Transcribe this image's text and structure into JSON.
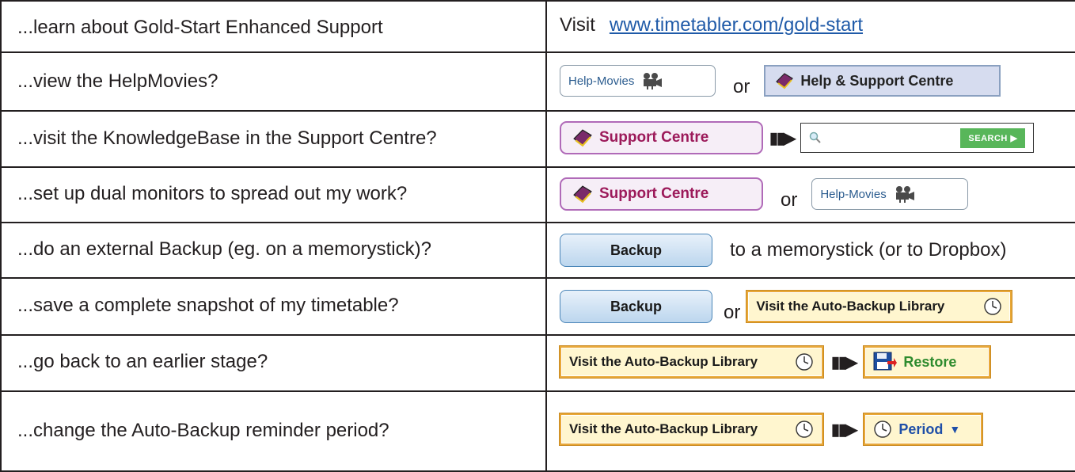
{
  "rows": [
    {
      "question": "...learn about Gold-Start Enhanced Support",
      "prefix": "Visit",
      "link": "www.timetabler.com/gold-start"
    },
    {
      "question": "...view the HelpMovies?"
    },
    {
      "question": "...visit the KnowledgeBase in the Support Centre?"
    },
    {
      "question": "...set up dual monitors to spread out my work?"
    },
    {
      "question": "...do an external Backup (eg. on a memorystick)?",
      "suffix": "to a memorystick (or to Dropbox)"
    },
    {
      "question": "...save a complete snapshot of my timetable?"
    },
    {
      "question": "...go back to an earlier stage?"
    },
    {
      "question": "...change the Auto-Backup reminder period?"
    }
  ],
  "labels": {
    "or": "or",
    "help_movies": "Help-Movies",
    "help_support_centre": "Help & Support Centre",
    "support_centre": "Support Centre",
    "search": "SEARCH",
    "backup": "Backup",
    "auto_backup_library": "Visit the Auto-Backup Library",
    "restore": "Restore",
    "period": "Period"
  },
  "icons": [
    "film-camera-icon",
    "book-icon",
    "magnifier-icon",
    "arrow-right-icon",
    "clock-icon",
    "floppy-disk-icon",
    "dropdown-arrow-icon"
  ],
  "colors": {
    "link": "#1f5aa8",
    "support_centre_text": "#9c1a5a",
    "restore_text": "#2e8b2e",
    "period_text": "#1f4fa8",
    "search_button": "#58b65a"
  }
}
